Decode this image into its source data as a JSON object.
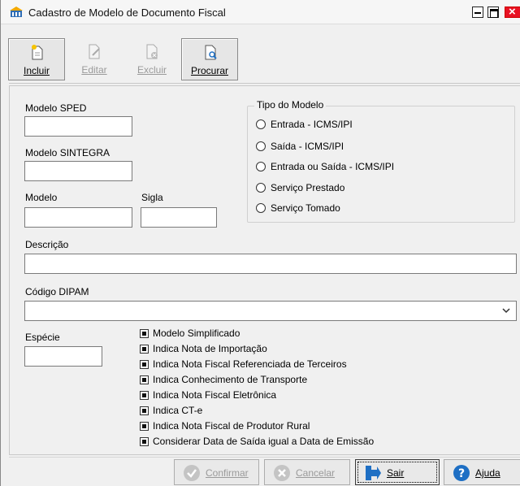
{
  "window": {
    "title": "Cadastro de Modelo de Documento Fiscal"
  },
  "toolbar": {
    "incluir": "Incluir",
    "editar": "Editar",
    "excluir": "Excluir",
    "procurar": "Procurar"
  },
  "form": {
    "modelo_sped": {
      "label": "Modelo SPED",
      "value": ""
    },
    "modelo_sintegra": {
      "label": "Modelo SINTEGRA",
      "value": ""
    },
    "modelo": {
      "label": "Modelo",
      "value": ""
    },
    "sigla": {
      "label": "Sigla",
      "value": ""
    },
    "descricao": {
      "label": "Descrição",
      "value": ""
    },
    "codigo_dipam": {
      "label": "Código DIPAM",
      "value": ""
    },
    "especie": {
      "label": "Espécie",
      "value": ""
    }
  },
  "tipo_modelo": {
    "title": "Tipo do Modelo",
    "options": [
      "Entrada - ICMS/IPI",
      "Saída - ICMS/IPI",
      "Entrada ou Saída - ICMS/IPI",
      "Serviço Prestado",
      "Serviço Tomado"
    ]
  },
  "checkboxes": [
    "Modelo Simplificado",
    "Indica Nota de Importação",
    "Indica Nota Fiscal Referenciada de Terceiros",
    "Indica Conhecimento de Transporte",
    "Indica Nota Fiscal Eletrônica",
    "Indica CT-e",
    "Indica Nota Fiscal de Produtor Rural",
    "Considerar Data de Saída igual a Data de Emissão"
  ],
  "buttons": {
    "confirmar": "Confirmar",
    "cancelar": "Cancelar",
    "sair": "Sair",
    "ajuda": "Ajuda"
  },
  "colors": {
    "close_button": "#e81123",
    "accent_blue": "#1e6fc4",
    "disabled_gray": "#9a9a9a"
  }
}
